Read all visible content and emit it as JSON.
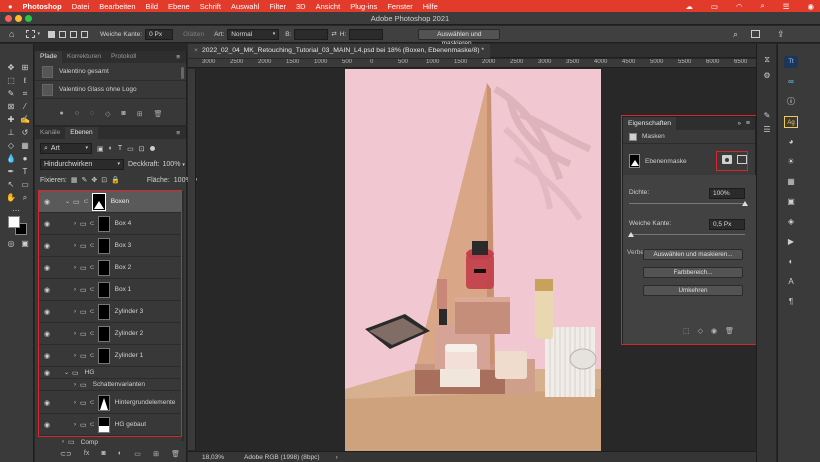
{
  "menubar": {
    "apple": "",
    "app": "Photoshop",
    "items": [
      "Datei",
      "Bearbeiten",
      "Bild",
      "Ebene",
      "Schrift",
      "Auswahl",
      "Filter",
      "3D",
      "Ansicht",
      "Plug-ins",
      "Fenster",
      "Hilfe"
    ],
    "status_icons": [
      "cloud-icon",
      "wifi-icon",
      "search-icon",
      "control-center-icon"
    ]
  },
  "window": {
    "title": "Adobe Photoshop 2021"
  },
  "options": {
    "feather_label": "Weiche Kante:",
    "feather_value": "0 Px",
    "smooth_label": "Glätten",
    "style_label": "Art:",
    "style_value": "Normal",
    "width_label": "B:",
    "height_label": "H:",
    "select_mask_button": "Auswählen und maskieren..."
  },
  "document": {
    "tab_title": "2022_02_04_MK_Retouching_Tutorial_03_MAIN_L4.psd bei 18% (Boxen, Ebenenmaske/8) *",
    "ruler_ticks": [
      "3000",
      "2500",
      "2000",
      "1500",
      "1000",
      "500",
      "0",
      "500",
      "1000",
      "1500",
      "2000",
      "2500",
      "3000",
      "3500",
      "4000",
      "4500",
      "5000",
      "5500",
      "6000",
      "6500"
    ],
    "zoom": "18,03%",
    "color_profile": "Adobe RGB (1998) (8bpc)"
  },
  "paths_panel": {
    "tabs": [
      "Pfade",
      "Korrekturen",
      "Protokoll"
    ],
    "items": [
      "Valentino gesamt",
      "Valentino Glass ohne Logo"
    ]
  },
  "layers_panel": {
    "tabs": [
      "Kanäle",
      "Ebenen"
    ],
    "filter_value": "Art",
    "blend_mode": "Hindurchwirken",
    "opacity_label": "Deckkraft:",
    "opacity_value": "100%",
    "lock_label": "Fixieren:",
    "fill_label": "Fläche:",
    "fill_value": "100%",
    "layers": [
      {
        "name": "Boxen"
      },
      {
        "name": "Box 4"
      },
      {
        "name": "Box 3"
      },
      {
        "name": "Box 2"
      },
      {
        "name": "Box 1"
      },
      {
        "name": "Zylinder 3"
      },
      {
        "name": "Zylinder 2"
      },
      {
        "name": "Zylinder 1"
      },
      {
        "name": "HG"
      },
      {
        "name": "Schattenvarianten"
      },
      {
        "name": "Hintergrundelemente"
      },
      {
        "name": "HG gebaut"
      },
      {
        "name": "Comp"
      }
    ]
  },
  "properties_panel": {
    "title": "Eigenschaften",
    "section": "Masken",
    "mask_name": "Ebenenmaske",
    "density_label": "Dichte:",
    "density_value": "100%",
    "density_fraction": 1.0,
    "feather_label": "Weiche Kante:",
    "feather_value": "0,5 Px",
    "feather_fraction": 0.02,
    "refine_label": "Verbe",
    "select_mask_button": "Auswählen und maskieren...",
    "color_range_button": "Farbbereich...",
    "invert_button": "Umkehren"
  },
  "colors": {
    "menubar": "#e23b2c",
    "highlight": "#d8262a",
    "selected_layer": "#5a5a5a"
  }
}
